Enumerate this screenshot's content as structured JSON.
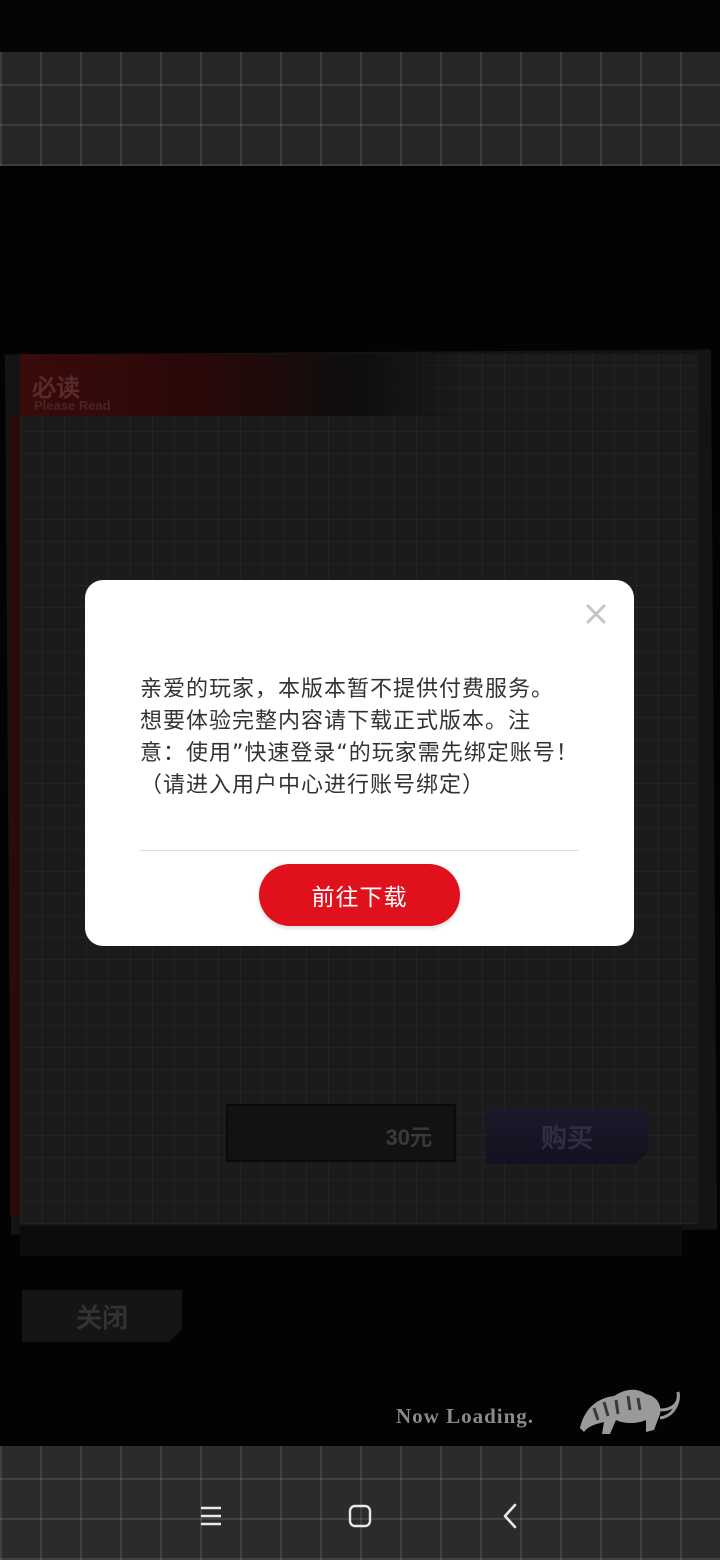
{
  "background": {
    "must_read": {
      "title": "必读",
      "subtitle": "Please Read"
    },
    "price": "30元",
    "buy_label": "购买",
    "close_label": "关闭",
    "loading_text": "Now Loading."
  },
  "modal": {
    "message": "亲爱的玩家，本版本暂不提供付费服务。\n想要体验完整内容请下载正式版本。注\n意：使用”快速登录“的玩家需先绑定账号！\n（请进入用户中心进行账号绑定）",
    "download_label": "前往下载"
  },
  "colors": {
    "accent_red": "#e0101c",
    "modal_bg": "#ffffff",
    "text": "#333333"
  },
  "navbar": {
    "icons": [
      "menu-icon",
      "home-icon",
      "back-icon"
    ]
  }
}
